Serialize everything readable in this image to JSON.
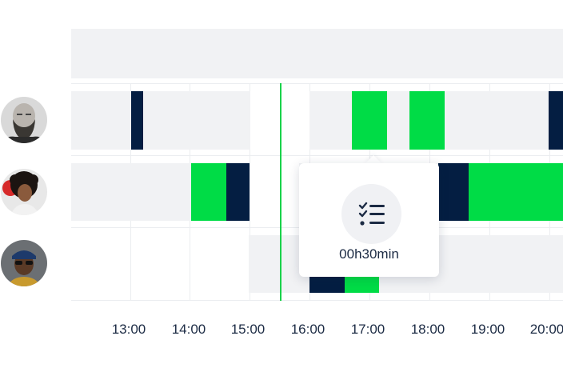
{
  "timeline": {
    "time_ticks": [
      "13:00",
      "14:00",
      "15:00",
      "16:00",
      "17:00",
      "18:00",
      "19:00",
      "20:00"
    ]
  },
  "people": [
    {
      "avatar_icon": "person-bald-bearded-icon"
    },
    {
      "avatar_icon": "person-curly-hair-icon"
    },
    {
      "avatar_icon": "person-cap-glasses-icon"
    }
  ],
  "tooltip": {
    "icon": "task-checklist-icon",
    "duration": "00h30min"
  },
  "colors": {
    "navy": "#041e42",
    "green": "#00dc46",
    "shift_bg": "#f1f2f4",
    "now_line": "#19d24a"
  }
}
